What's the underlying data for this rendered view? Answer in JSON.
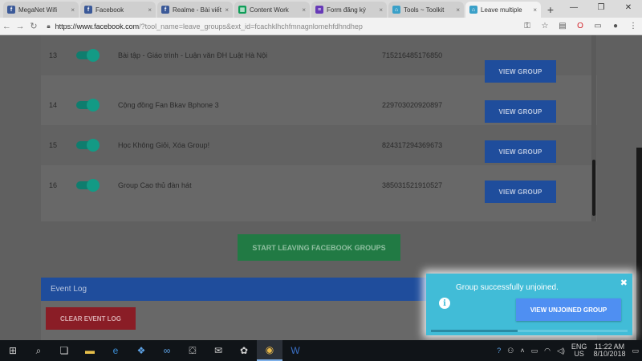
{
  "browser": {
    "tabs": [
      {
        "title": "MegaNet Wifi",
        "favicon": "facebook-icon",
        "color": "#3b5998"
      },
      {
        "title": "Facebook",
        "favicon": "facebook-icon",
        "color": "#3b5998"
      },
      {
        "title": "Realme - Bài viết",
        "favicon": "facebook-icon",
        "color": "#3b5998"
      },
      {
        "title": "Content Work",
        "favicon": "sheets-icon",
        "color": "#0f9d58"
      },
      {
        "title": "Form đăng ký",
        "favicon": "forms-icon",
        "color": "#673ab7"
      },
      {
        "title": "Tools ~ Toolkit",
        "favicon": "tool-icon",
        "color": "#3aa0c8"
      },
      {
        "title": "Leave multiple",
        "favicon": "tool-icon",
        "color": "#3aa0c8"
      }
    ],
    "url_host": "https://www.facebook.com",
    "url_path": "/?tool_name=leave_groups&ext_id=fcachklhchfmnagnlomehfdhndhep"
  },
  "groups": [
    {
      "num": "13",
      "name": "Bài tập - Giáo trình - Luận văn ĐH Luật Hà Nội",
      "id": "715216485176850",
      "enabled": true,
      "button": "VIEW GROUP"
    },
    {
      "num": "14",
      "name": "Cộng đồng Fan Bkav Bphone 3",
      "id": "229703020920897",
      "enabled": true,
      "button": "VIEW GROUP"
    },
    {
      "num": "15",
      "name": "Học Không Giỏi, Xóa Group!",
      "id": "824317294369673",
      "enabled": true,
      "button": "VIEW GROUP"
    },
    {
      "num": "16",
      "name": "Group Cao thủ đàn hát",
      "id": "385031521910527",
      "enabled": true,
      "button": "VIEW GROUP"
    }
  ],
  "actions": {
    "start_label": "START LEAVING FACEBOOK GROUPS"
  },
  "event_log": {
    "title": "Event Log",
    "clear_label": "CLEAR EVENT LOG"
  },
  "toast": {
    "message": "Group successfully unjoined.",
    "button_label": "VIEW UNJOINED GROUP",
    "close_glyph": "✖",
    "progress": 0.44
  },
  "taskbar": {
    "lang": "ENG",
    "region": "US",
    "time": "11:22 AM",
    "date": "8/10/2018"
  },
  "colors": {
    "toast_bg": "#41bcd7",
    "primary_button": "#1f4d9c",
    "start_button": "#217a44",
    "clear_button": "#8a1d26",
    "toast_button": "#4f8ff2"
  }
}
